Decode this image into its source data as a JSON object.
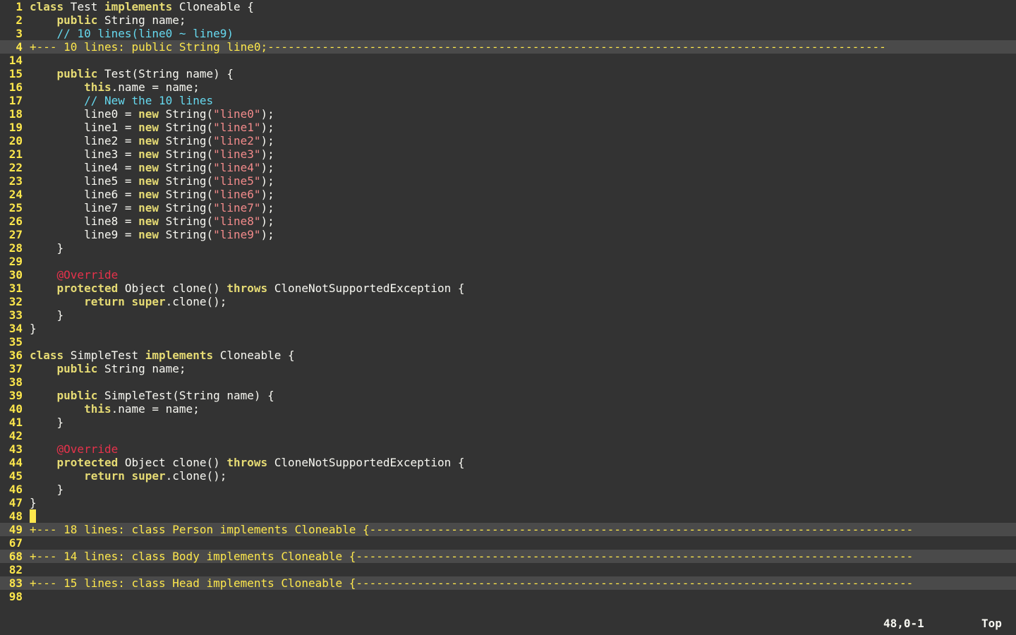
{
  "app": {
    "title": "vim"
  },
  "colors": {
    "background": "#333333",
    "line_number": "#fde74c",
    "fold_line_background": "#4a4a4a",
    "keyword": "#e6db74",
    "comment": "#66d9ef",
    "string": "#f38b8b",
    "annotation": "#e6324b",
    "text": "#f8f8f2",
    "cursor": "#fde74c"
  },
  "lines": [
    {
      "n": "1",
      "tokens": [
        {
          "t": "kw",
          "v": "class"
        },
        {
          "t": "tx",
          "v": " Test "
        },
        {
          "t": "kw",
          "v": "implements"
        },
        {
          "t": "tx",
          "v": " Cloneable {"
        }
      ]
    },
    {
      "n": "2",
      "tokens": [
        {
          "t": "tx",
          "v": "    "
        },
        {
          "t": "kw",
          "v": "public"
        },
        {
          "t": "tx",
          "v": " String name;"
        }
      ]
    },
    {
      "n": "3",
      "tokens": [
        {
          "t": "tx",
          "v": "    "
        },
        {
          "t": "cm",
          "v": "// 10 lines(line0 ~ line9)"
        }
      ]
    },
    {
      "n": "4",
      "fold": true,
      "text": "+--- 10 lines: public String line0;-------------------------------------------------------------------------------------------"
    },
    {
      "n": "14",
      "tokens": []
    },
    {
      "n": "15",
      "tokens": [
        {
          "t": "tx",
          "v": "    "
        },
        {
          "t": "kw",
          "v": "public"
        },
        {
          "t": "tx",
          "v": " Test(String name) {"
        }
      ]
    },
    {
      "n": "16",
      "tokens": [
        {
          "t": "tx",
          "v": "        "
        },
        {
          "t": "kw",
          "v": "this"
        },
        {
          "t": "tx",
          "v": ".name = name;"
        }
      ]
    },
    {
      "n": "17",
      "tokens": [
        {
          "t": "tx",
          "v": "        "
        },
        {
          "t": "cm",
          "v": "// New the 10 lines"
        }
      ]
    },
    {
      "n": "18",
      "tokens": [
        {
          "t": "tx",
          "v": "        line0 = "
        },
        {
          "t": "kw",
          "v": "new"
        },
        {
          "t": "tx",
          "v": " String("
        },
        {
          "t": "str",
          "v": "\"line0\""
        },
        {
          "t": "tx",
          "v": ");"
        }
      ]
    },
    {
      "n": "19",
      "tokens": [
        {
          "t": "tx",
          "v": "        line1 = "
        },
        {
          "t": "kw",
          "v": "new"
        },
        {
          "t": "tx",
          "v": " String("
        },
        {
          "t": "str",
          "v": "\"line1\""
        },
        {
          "t": "tx",
          "v": ");"
        }
      ]
    },
    {
      "n": "20",
      "tokens": [
        {
          "t": "tx",
          "v": "        line2 = "
        },
        {
          "t": "kw",
          "v": "new"
        },
        {
          "t": "tx",
          "v": " String("
        },
        {
          "t": "str",
          "v": "\"line2\""
        },
        {
          "t": "tx",
          "v": ");"
        }
      ]
    },
    {
      "n": "21",
      "tokens": [
        {
          "t": "tx",
          "v": "        line3 = "
        },
        {
          "t": "kw",
          "v": "new"
        },
        {
          "t": "tx",
          "v": " String("
        },
        {
          "t": "str",
          "v": "\"line3\""
        },
        {
          "t": "tx",
          "v": ");"
        }
      ]
    },
    {
      "n": "22",
      "tokens": [
        {
          "t": "tx",
          "v": "        line4 = "
        },
        {
          "t": "kw",
          "v": "new"
        },
        {
          "t": "tx",
          "v": " String("
        },
        {
          "t": "str",
          "v": "\"line4\""
        },
        {
          "t": "tx",
          "v": ");"
        }
      ]
    },
    {
      "n": "23",
      "tokens": [
        {
          "t": "tx",
          "v": "        line5 = "
        },
        {
          "t": "kw",
          "v": "new"
        },
        {
          "t": "tx",
          "v": " String("
        },
        {
          "t": "str",
          "v": "\"line5\""
        },
        {
          "t": "tx",
          "v": ");"
        }
      ]
    },
    {
      "n": "24",
      "tokens": [
        {
          "t": "tx",
          "v": "        line6 = "
        },
        {
          "t": "kw",
          "v": "new"
        },
        {
          "t": "tx",
          "v": " String("
        },
        {
          "t": "str",
          "v": "\"line6\""
        },
        {
          "t": "tx",
          "v": ");"
        }
      ]
    },
    {
      "n": "25",
      "tokens": [
        {
          "t": "tx",
          "v": "        line7 = "
        },
        {
          "t": "kw",
          "v": "new"
        },
        {
          "t": "tx",
          "v": " String("
        },
        {
          "t": "str",
          "v": "\"line7\""
        },
        {
          "t": "tx",
          "v": ");"
        }
      ]
    },
    {
      "n": "26",
      "tokens": [
        {
          "t": "tx",
          "v": "        line8 = "
        },
        {
          "t": "kw",
          "v": "new"
        },
        {
          "t": "tx",
          "v": " String("
        },
        {
          "t": "str",
          "v": "\"line8\""
        },
        {
          "t": "tx",
          "v": ");"
        }
      ]
    },
    {
      "n": "27",
      "tokens": [
        {
          "t": "tx",
          "v": "        line9 = "
        },
        {
          "t": "kw",
          "v": "new"
        },
        {
          "t": "tx",
          "v": " String("
        },
        {
          "t": "str",
          "v": "\"line9\""
        },
        {
          "t": "tx",
          "v": ");"
        }
      ]
    },
    {
      "n": "28",
      "tokens": [
        {
          "t": "tx",
          "v": "    }"
        }
      ]
    },
    {
      "n": "29",
      "tokens": []
    },
    {
      "n": "30",
      "tokens": [
        {
          "t": "tx",
          "v": "    "
        },
        {
          "t": "ann",
          "v": "@Override"
        }
      ]
    },
    {
      "n": "31",
      "tokens": [
        {
          "t": "tx",
          "v": "    "
        },
        {
          "t": "kw",
          "v": "protected"
        },
        {
          "t": "tx",
          "v": " Object clone() "
        },
        {
          "t": "kw",
          "v": "throws"
        },
        {
          "t": "tx",
          "v": " CloneNotSupportedException {"
        }
      ]
    },
    {
      "n": "32",
      "tokens": [
        {
          "t": "tx",
          "v": "        "
        },
        {
          "t": "kw",
          "v": "return"
        },
        {
          "t": "tx",
          "v": " "
        },
        {
          "t": "kw",
          "v": "super"
        },
        {
          "t": "tx",
          "v": ".clone();"
        }
      ]
    },
    {
      "n": "33",
      "tokens": [
        {
          "t": "tx",
          "v": "    }"
        }
      ]
    },
    {
      "n": "34",
      "tokens": [
        {
          "t": "tx",
          "v": "}"
        }
      ]
    },
    {
      "n": "35",
      "tokens": []
    },
    {
      "n": "36",
      "tokens": [
        {
          "t": "kw",
          "v": "class"
        },
        {
          "t": "tx",
          "v": " SimpleTest "
        },
        {
          "t": "kw",
          "v": "implements"
        },
        {
          "t": "tx",
          "v": " Cloneable {"
        }
      ]
    },
    {
      "n": "37",
      "tokens": [
        {
          "t": "tx",
          "v": "    "
        },
        {
          "t": "kw",
          "v": "public"
        },
        {
          "t": "tx",
          "v": " String name;"
        }
      ]
    },
    {
      "n": "38",
      "tokens": []
    },
    {
      "n": "39",
      "tokens": [
        {
          "t": "tx",
          "v": "    "
        },
        {
          "t": "kw",
          "v": "public"
        },
        {
          "t": "tx",
          "v": " SimpleTest(String name) {"
        }
      ]
    },
    {
      "n": "40",
      "tokens": [
        {
          "t": "tx",
          "v": "        "
        },
        {
          "t": "kw",
          "v": "this"
        },
        {
          "t": "tx",
          "v": ".name = name;"
        }
      ]
    },
    {
      "n": "41",
      "tokens": [
        {
          "t": "tx",
          "v": "    }"
        }
      ]
    },
    {
      "n": "42",
      "tokens": []
    },
    {
      "n": "43",
      "tokens": [
        {
          "t": "tx",
          "v": "    "
        },
        {
          "t": "ann",
          "v": "@Override"
        }
      ]
    },
    {
      "n": "44",
      "tokens": [
        {
          "t": "tx",
          "v": "    "
        },
        {
          "t": "kw",
          "v": "protected"
        },
        {
          "t": "tx",
          "v": " Object clone() "
        },
        {
          "t": "kw",
          "v": "throws"
        },
        {
          "t": "tx",
          "v": " CloneNotSupportedException {"
        }
      ]
    },
    {
      "n": "45",
      "tokens": [
        {
          "t": "tx",
          "v": "        "
        },
        {
          "t": "kw",
          "v": "return"
        },
        {
          "t": "tx",
          "v": " "
        },
        {
          "t": "kw",
          "v": "super"
        },
        {
          "t": "tx",
          "v": ".clone();"
        }
      ]
    },
    {
      "n": "46",
      "tokens": [
        {
          "t": "tx",
          "v": "    }"
        }
      ]
    },
    {
      "n": "47",
      "tokens": [
        {
          "t": "tx",
          "v": "}"
        }
      ]
    },
    {
      "n": "48",
      "cursor": true,
      "tokens": []
    },
    {
      "n": "49",
      "fold": true,
      "text": "+--- 18 lines: class Person implements Cloneable {--------------------------------------------------------------------------------"
    },
    {
      "n": "67",
      "tokens": []
    },
    {
      "n": "68",
      "fold": true,
      "text": "+--- 14 lines: class Body implements Cloneable {----------------------------------------------------------------------------------"
    },
    {
      "n": "82",
      "tokens": []
    },
    {
      "n": "83",
      "fold": true,
      "text": "+--- 15 lines: class Head implements Cloneable {----------------------------------------------------------------------------------"
    },
    {
      "n": "98",
      "tokens": []
    }
  ],
  "statusbar": {
    "position": "48,0-1",
    "scroll": "Top"
  }
}
